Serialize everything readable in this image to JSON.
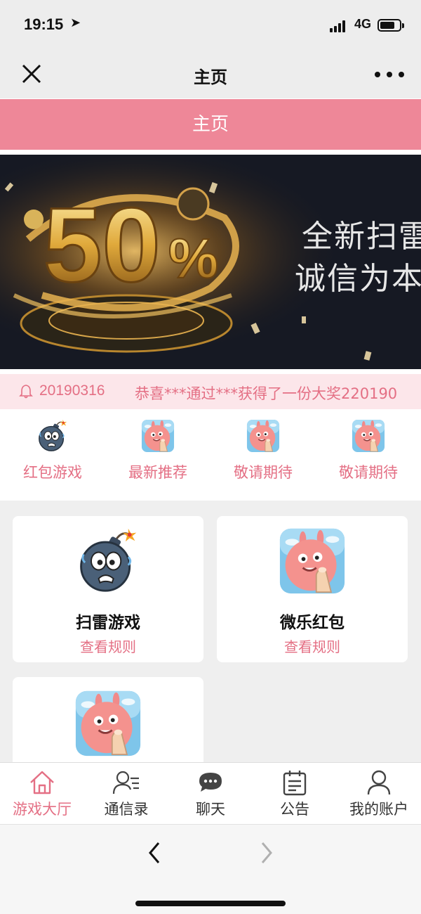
{
  "status": {
    "time": "19:15",
    "network": "4G"
  },
  "nav": {
    "title": "主页"
  },
  "header": {
    "title": "主页"
  },
  "banner": {
    "big_text": "50",
    "percent": "%",
    "line1": "全新扫雷",
    "line2": "诚信为本"
  },
  "notice": {
    "date": "20190316",
    "text": "恭喜***通过***获得了一份大奖220190"
  },
  "quick_menu": [
    {
      "label": "红包游戏",
      "icon": "bomb-icon"
    },
    {
      "label": "最新推荐",
      "icon": "pig-icon"
    },
    {
      "label": "敬请期待",
      "icon": "pig-icon"
    },
    {
      "label": "敬请期待",
      "icon": "pig-icon"
    }
  ],
  "cards": [
    {
      "title": "扫雷游戏",
      "rule": "查看规则",
      "icon": "bomb-icon"
    },
    {
      "title": "微乐红包",
      "rule": "查看规则",
      "icon": "pig-icon"
    },
    {
      "title": "",
      "rule": "",
      "icon": "pig-icon"
    }
  ],
  "tabs": [
    {
      "label": "游戏大厅",
      "icon": "home-icon",
      "active": true
    },
    {
      "label": "通信录",
      "icon": "contacts-icon"
    },
    {
      "label": "聊天",
      "icon": "chat-icon"
    },
    {
      "label": "公告",
      "icon": "notice-board-icon"
    },
    {
      "label": "我的账户",
      "icon": "user-icon"
    }
  ],
  "colors": {
    "accent": "#ee8798",
    "accent_text": "#e46f84",
    "notice_bg": "#fce6ea",
    "nav_bg": "#ededed"
  }
}
